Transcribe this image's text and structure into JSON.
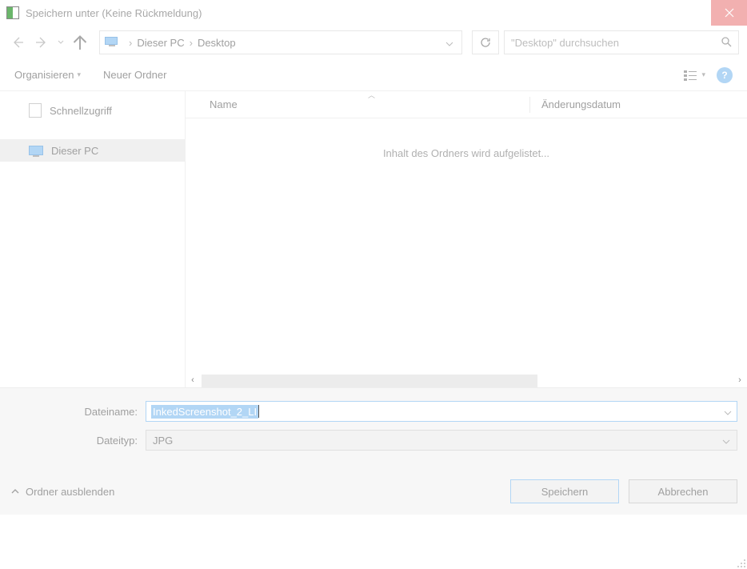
{
  "window": {
    "title": "Speichern unter (Keine Rückmeldung)"
  },
  "breadcrumb": {
    "pc": "Dieser PC",
    "folder": "Desktop"
  },
  "search": {
    "placeholder": "\"Desktop\" durchsuchen"
  },
  "toolbar": {
    "organize": "Organisieren",
    "new_folder": "Neuer Ordner"
  },
  "sidebar": {
    "quick_access": "Schnellzugriff",
    "this_pc": "Dieser PC"
  },
  "columns": {
    "name": "Name",
    "modified": "Änderungsdatum"
  },
  "filelist": {
    "loading": "Inhalt des Ordners wird aufgelistet..."
  },
  "form": {
    "filename_label": "Dateiname:",
    "filename_value": "InkedScreenshot_2_LI",
    "filetype_label": "Dateityp:",
    "filetype_value": "JPG"
  },
  "footer": {
    "hide_folders": "Ordner ausblenden",
    "save": "Speichern",
    "cancel": "Abbrechen"
  }
}
